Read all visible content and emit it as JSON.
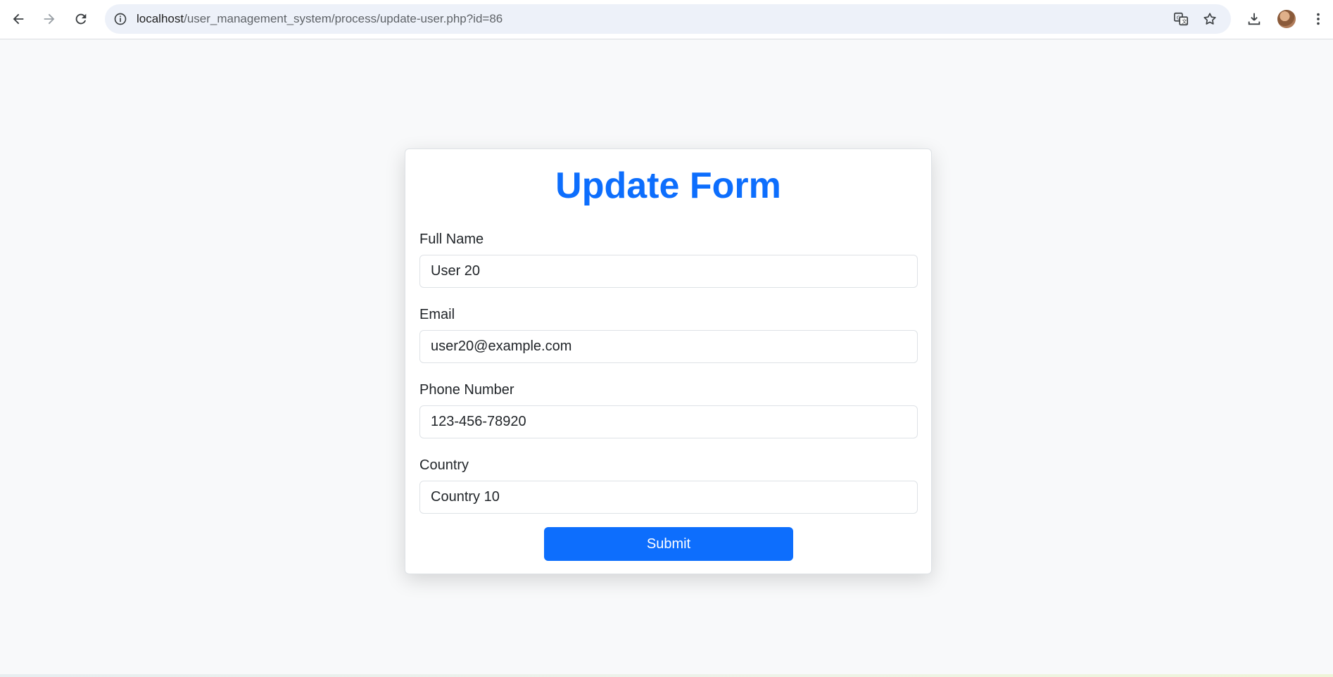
{
  "browser": {
    "url_host": "localhost",
    "url_path": "/user_management_system/process/update-user.php?id=86",
    "icons": {
      "back": "back-arrow-icon",
      "forward": "forward-arrow-icon",
      "reload": "reload-icon",
      "site_info": "info-icon",
      "translate": "translate-icon",
      "bookmark": "star-icon",
      "download": "download-icon",
      "profile": "avatar",
      "menu": "kebab-menu-icon"
    }
  },
  "form": {
    "title": "Update Form",
    "title_color": "#0d6efd",
    "fields": [
      {
        "label": "Full Name",
        "value": "User 20"
      },
      {
        "label": "Email",
        "value": "user20@example.com"
      },
      {
        "label": "Phone Number",
        "value": "123-456-78920"
      },
      {
        "label": "Country",
        "value": "Country 10"
      }
    ],
    "submit_label": "Submit",
    "submit_color": "#0d6efd"
  }
}
